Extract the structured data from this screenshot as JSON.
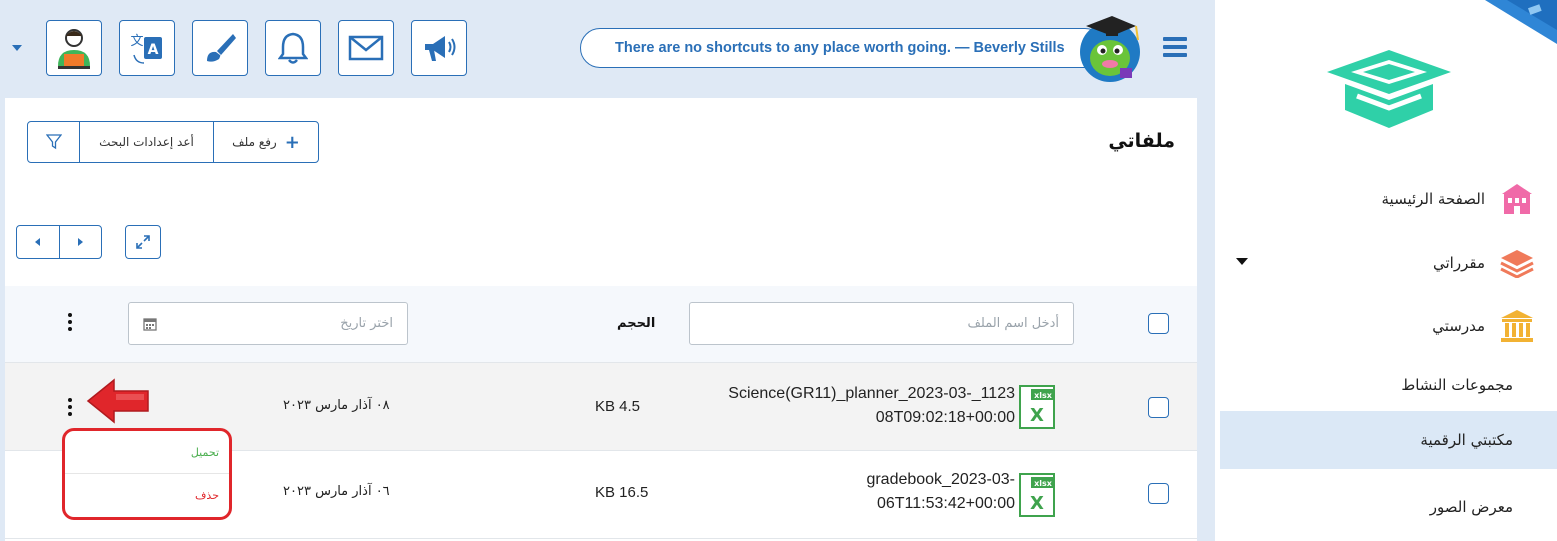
{
  "topbar": {
    "quote": "There are no shortcuts to any place worth going. — Beverly Stills",
    "buttons": [
      {
        "icon": "teacher-avatar-icon"
      },
      {
        "icon": "translate-icon"
      },
      {
        "icon": "paintbrush-icon"
      },
      {
        "icon": "bell-icon"
      },
      {
        "icon": "mail-icon"
      },
      {
        "icon": "megaphone-icon"
      }
    ],
    "accent_color": "#2a6fb7"
  },
  "sidebar": {
    "items": [
      {
        "label": "الصفحة الرئيسية",
        "icon": "school-building-icon",
        "color": "#f06aa8"
      },
      {
        "label": "مقرراتي",
        "icon": "books-stack-icon",
        "color": "#f07a5a"
      },
      {
        "label": "مدرستي",
        "icon": "institution-icon",
        "color": "#f2b233"
      },
      {
        "label": "مجموعات النشاط"
      },
      {
        "label": "مكتبتي الرقمية",
        "active": true
      },
      {
        "label": "معرض الصور"
      }
    ]
  },
  "page": {
    "title": "ملفاتي",
    "upload_label": "رفع ملف",
    "reset_label": "أعد إعدادات البحث"
  },
  "table": {
    "filename_placeholder": "أدخل اسم الملف",
    "size_header": "الحجم",
    "date_placeholder": "اختر تاريخ",
    "rows": [
      {
        "name_line1": "Science(GR11)_planner_2023-03-_1123",
        "name_line2": "08T09:02:18+00:00",
        "file_type": "xlsx",
        "size": "KB 4.5",
        "date": "٠٨ آذار مارس ٢٠٢٣"
      },
      {
        "name_line1": "gradebook_2023-03-",
        "name_line2": "06T11:53:42+00:00",
        "file_type": "xlsx",
        "size": "KB 16.5",
        "date": "٠٦ آذار مارس ٢٠٢٣"
      }
    ]
  },
  "row_menu": {
    "download_label": "تحميل",
    "delete_label": "حذف",
    "download_color": "#4caf50",
    "delete_color": "#e0262b"
  }
}
